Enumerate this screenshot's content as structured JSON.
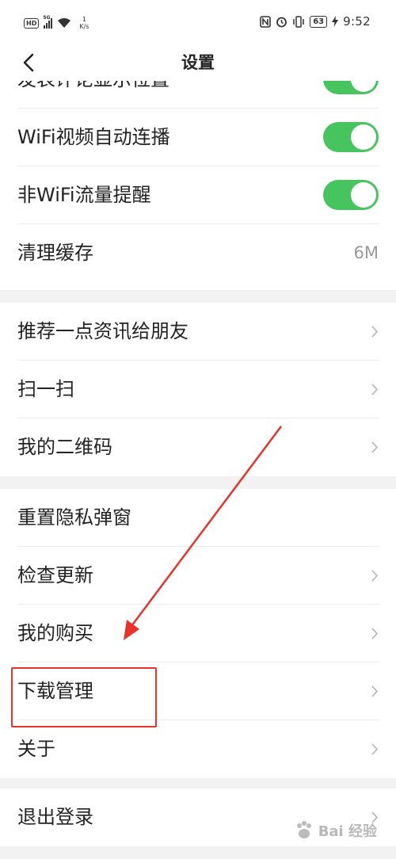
{
  "status_bar": {
    "hd": "HD",
    "network_type": "5G",
    "speed_value": "1",
    "speed_unit": "K/s",
    "battery": "63",
    "time": "9:52"
  },
  "nav": {
    "title": "设置",
    "back_icon": "chevron-left-icon"
  },
  "groups": [
    {
      "items": [
        {
          "label": "发表评论显示位置",
          "control": "toggle",
          "on": true
        },
        {
          "label": "WiFi视频自动连播",
          "control": "toggle",
          "on": true
        },
        {
          "label": "非WiFi流量提醒",
          "control": "toggle",
          "on": true
        },
        {
          "label": "清理缓存",
          "control": "value",
          "value": "6M"
        }
      ]
    },
    {
      "items": [
        {
          "label": "推荐一点资讯给朋友",
          "control": "chevron"
        },
        {
          "label": "扫一扫",
          "control": "chevron"
        },
        {
          "label": "我的二维码",
          "control": "chevron"
        }
      ]
    },
    {
      "items": [
        {
          "label": "重置隐私弹窗",
          "control": "none"
        },
        {
          "label": "检查更新",
          "control": "chevron"
        },
        {
          "label": "我的购买",
          "control": "chevron"
        },
        {
          "label": "下载管理",
          "control": "chevron"
        },
        {
          "label": "关于",
          "control": "chevron"
        }
      ]
    },
    {
      "items": [
        {
          "label": "退出登录",
          "control": "chevron"
        }
      ]
    }
  ],
  "annotation": {
    "highlighted_item": "下载管理",
    "color": "#e8332a"
  },
  "colors": {
    "toggle_on": "#46c45d",
    "background": "#f2f2f2"
  },
  "watermark": {
    "text": "Bai 经验"
  }
}
